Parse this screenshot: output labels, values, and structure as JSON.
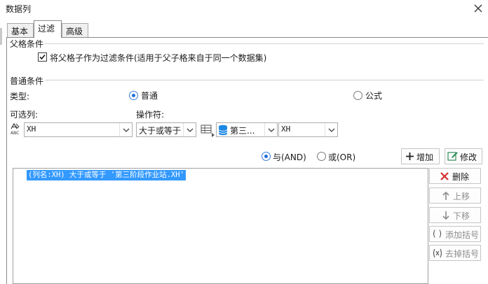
{
  "window": {
    "title": "数据列"
  },
  "tabs": [
    {
      "label": "基本",
      "active": false
    },
    {
      "label": "过滤",
      "active": true
    },
    {
      "label": "高级",
      "active": false
    }
  ],
  "parent_condition": {
    "section_title": "父格条件",
    "checkbox_label": "将父格子作为过滤条件(适用于父子格来自于同一个数据集)",
    "checked": true
  },
  "normal_condition": {
    "section_title": "普通条件",
    "type_label": "类型:",
    "type_options": [
      {
        "label": "普通",
        "selected": true
      },
      {
        "label": "公式",
        "selected": false
      }
    ],
    "column_label": "可选列:",
    "operator_label": "操作符:",
    "column_value": "XH",
    "operator_value": "大于或等于",
    "dataset_value": "第三...",
    "value_column": "XH"
  },
  "logic": {
    "and_label": "与(AND)",
    "or_label": "或(OR)",
    "selected": "and"
  },
  "buttons": {
    "add": "增加",
    "modify": "修改",
    "delete": "删除",
    "move_up": "上移",
    "move_down": "下移",
    "add_bracket": "添加括号",
    "remove_bracket": "去掉括号"
  },
  "conditions": [
    {
      "text": "(列名:XH) 大于或等于 '第三阶段作业站.XH'",
      "selected": true
    }
  ],
  "colors": {
    "selection": "#3399ff",
    "radio_accent": "#1e6fd9",
    "delete_red": "#d32f2f",
    "add_bracket_green": "#2e8b57",
    "dataset_blue": "#1e88e5"
  }
}
